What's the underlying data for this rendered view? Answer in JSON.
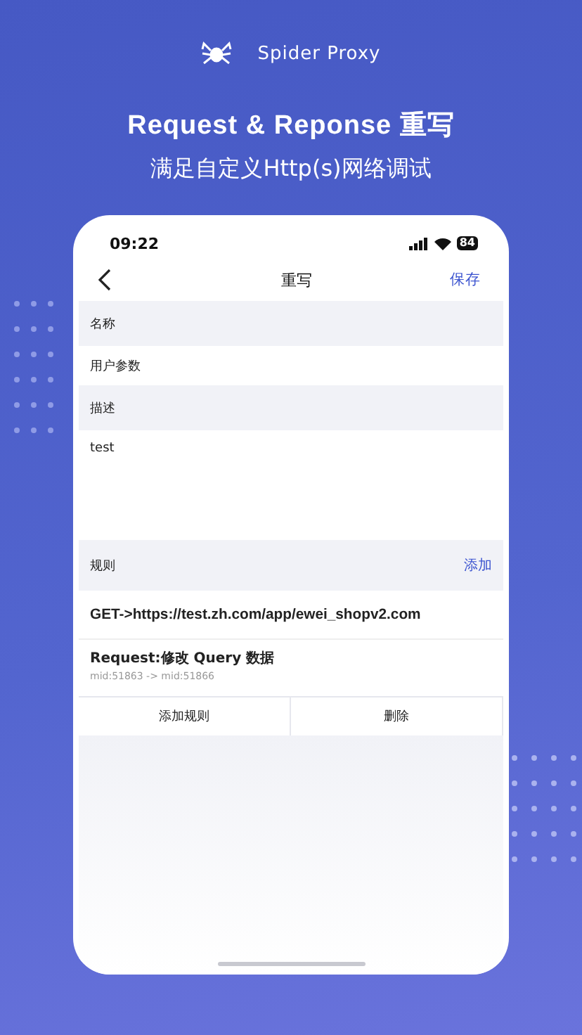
{
  "app_name": "Spider Proxy",
  "headline": "Request & Reponse 重写",
  "subtitle": "满足自定义Http(s)网络调试",
  "status_bar": {
    "time": "09:22",
    "battery": "84"
  },
  "nav": {
    "title": "重写",
    "action": "保存"
  },
  "name_field": {
    "label": "名称",
    "value": "用户参数"
  },
  "description_field": {
    "label": "描述",
    "value": "test"
  },
  "rules": {
    "label": "规则",
    "action": "添加",
    "url": "GET->https://test.zh.com/app/ewei_shopv2.com",
    "items": [
      {
        "title": "Request:修改 Query 数据",
        "detail": "mid:51863 -> mid:51866"
      }
    ]
  },
  "buttons": [
    "添加规则",
    "删除"
  ]
}
